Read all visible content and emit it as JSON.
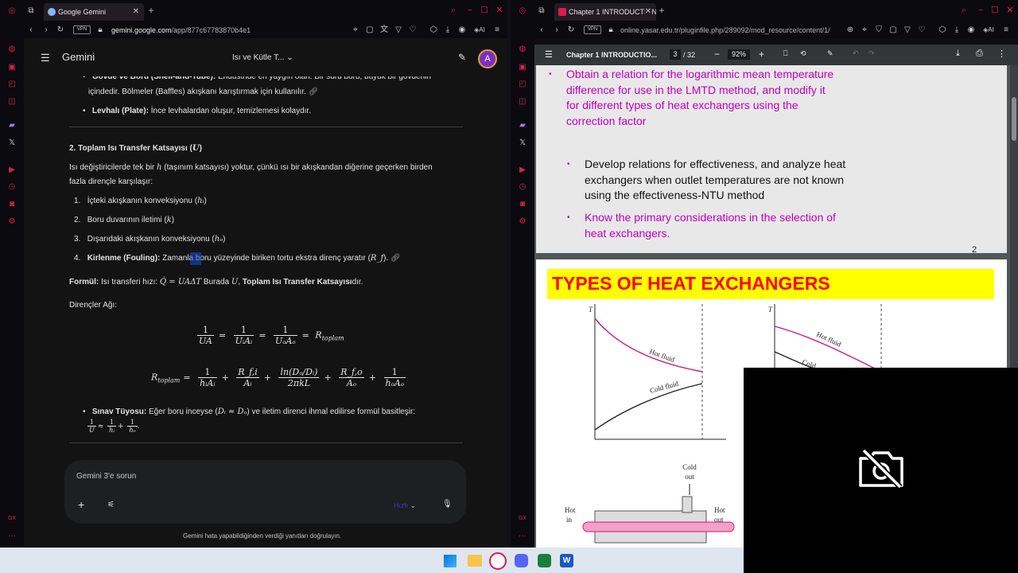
{
  "left_window": {
    "tab_title": "Google Gemini",
    "url_domain": "gemini.google.com",
    "url_path": "/app/877c67783870b4e1",
    "vpn_label": "VPN",
    "header": {
      "title": "Gemini",
      "chat_title": "Isı ve Kütle T...",
      "avatar_letter": "A"
    },
    "content": {
      "line_top_bullet_label": "Gövde ve Boru (Shell-and-Tube):",
      "line_top_bullet_text": " Endüstride en yaygın olan. Bir sürü boru, büyük bir gövdenin",
      "line_top_bullet_cont": "içindedir. Bölmeler (Baffles) akışkanı karıştırmak için kullanılır.",
      "plate_label": "Levhalı (Plate):",
      "plate_text": " İnce levhalardan oluşur, temizlemesi kolaydır.",
      "section_heading": "2. Toplam Isı Transfer Katsayısı (",
      "section_heading_var": "U",
      "section_heading_close": ")",
      "intro_1": "Isı değiştiricilerde tek bir ",
      "intro_var": "h",
      "intro_2": " (taşınım katsayısı) yoktur, çünkü ısı bir akışkandan diğerine geçerken birden",
      "intro_3": "fazla dirençle karşılaşır:",
      "list": [
        {
          "num": "1.",
          "text": "İçteki akışkanın konveksiyonu (",
          "var": "hᵢ",
          "close": ")"
        },
        {
          "num": "2.",
          "text": "Boru duvarının iletimi (",
          "var": "k",
          "close": ")"
        },
        {
          "num": "3.",
          "text": "Dışarıdaki akışkanın konveksiyonu (",
          "var": "hₒ",
          "close": ")"
        },
        {
          "num": "4.",
          "bold": "Kirlenme (Fouling):",
          "text": " Zamanla boru yüzeyinde biriken tortu ekstra direnç yaratır (",
          "var": "R_f",
          "close": ")."
        }
      ],
      "formula_label": "Formül:",
      "formula_text": " Isı transferi hızı: ",
      "formula_math": "Q̇ = UAΔT",
      "formula_tail_1": " Burada ",
      "formula_tail_var": "U",
      "formula_tail_2": ", ",
      "formula_tail_bold": "Toplam Isı Transfer Katsayısı",
      "formula_tail_3": "dır.",
      "network_label": "Dirençler Ağı:",
      "eq1": {
        "lhs_n": "1",
        "lhs_d": "UA",
        "f1_n": "1",
        "f1_d": "UᵢAᵢ",
        "f2_n": "1",
        "f2_d": "UₒAₒ",
        "rhs": "R",
        "rhs_sub": "toplam"
      },
      "eq2": {
        "lhs": "R",
        "lhs_sub": "toplam",
        "t1_n": "1",
        "t1_d": "hᵢAᵢ",
        "t2_n": "R_f,i",
        "t2_d": "Aᵢ",
        "t3_n": "ln(Dₒ/Dᵢ)",
        "t3_d": "2πkL",
        "t4_n": "R_f,o",
        "t4_d": "Aₒ",
        "t5_n": "1",
        "t5_d": "hₒAₒ"
      },
      "tip_label": "Sınav Tüyosu:",
      "tip_text": " Eğer boru inceyse (",
      "tip_math": "Dᵢ ≈ Dₒ",
      "tip_text2": ") ve iletim direnci ihmal edilirse formül basitleşir:",
      "tip_eq": {
        "lhs_n": "1",
        "lhs_d": "U",
        "a_n": "1",
        "a_d": "hᵢ",
        "b_n": "1",
        "b_d": "hₒ"
      }
    },
    "input": {
      "placeholder": "Gemini 3'e sorun",
      "model_label": "Hızlı"
    },
    "footer_note": "Gemini hata yapabildiğinden verdiği yanıtları doğrulayın."
  },
  "right_window": {
    "tab_title": "Chapter 1 INTRODUCTION",
    "url": "online.yasar.edu.tr/pluginfile.php/289092/mod_resource/content/1/",
    "vpn_label": "VPN",
    "pdf": {
      "doc_title": "Chapter 1 INTRODUCTIO...",
      "page_current": "3",
      "page_total": "/ 32",
      "zoom": "92%",
      "page2_number": "2",
      "bullets": [
        {
          "color": "#c000c0",
          "lines": [
            "Obtain a relation for the logarithmic mean temperature",
            "difference for use in the LMTD method, and modify it",
            "for different types of heat exchangers using the",
            "correction factor"
          ]
        },
        {
          "color": "#111111",
          "lines": [
            "Develop relations for effectiveness, and analyze heat",
            "exchangers when outlet temperatures are not known",
            "using the effectiveness-NTU method"
          ]
        },
        {
          "color": "#c000c0",
          "lines": [
            "Know the primary considerations in the selection of",
            "heat exchangers."
          ]
        }
      ],
      "page3_title": "TYPES OF HEAT EXCHANGERS",
      "figure": {
        "axis_t": "T",
        "hot_fluid": "Hot fluid",
        "cold_fluid": "Cold fluid",
        "cold_out": "Cold\nout",
        "cold_out_1": "Cold",
        "cold_out_2": "out",
        "hot_in_1": "Hot",
        "hot_in_2": "in",
        "hot_out_1": "Hot",
        "hot_out_2": "out",
        "axis_t2": "T",
        "hot_fluid2": "Hot fluid",
        "cold2": "Cold"
      }
    }
  },
  "colors": {
    "accent": "#e0194e",
    "gemini_bg": "#131314",
    "pdf_magenta": "#c000c0",
    "title_yellow": "#ffff00",
    "title_red": "#ff0000"
  }
}
